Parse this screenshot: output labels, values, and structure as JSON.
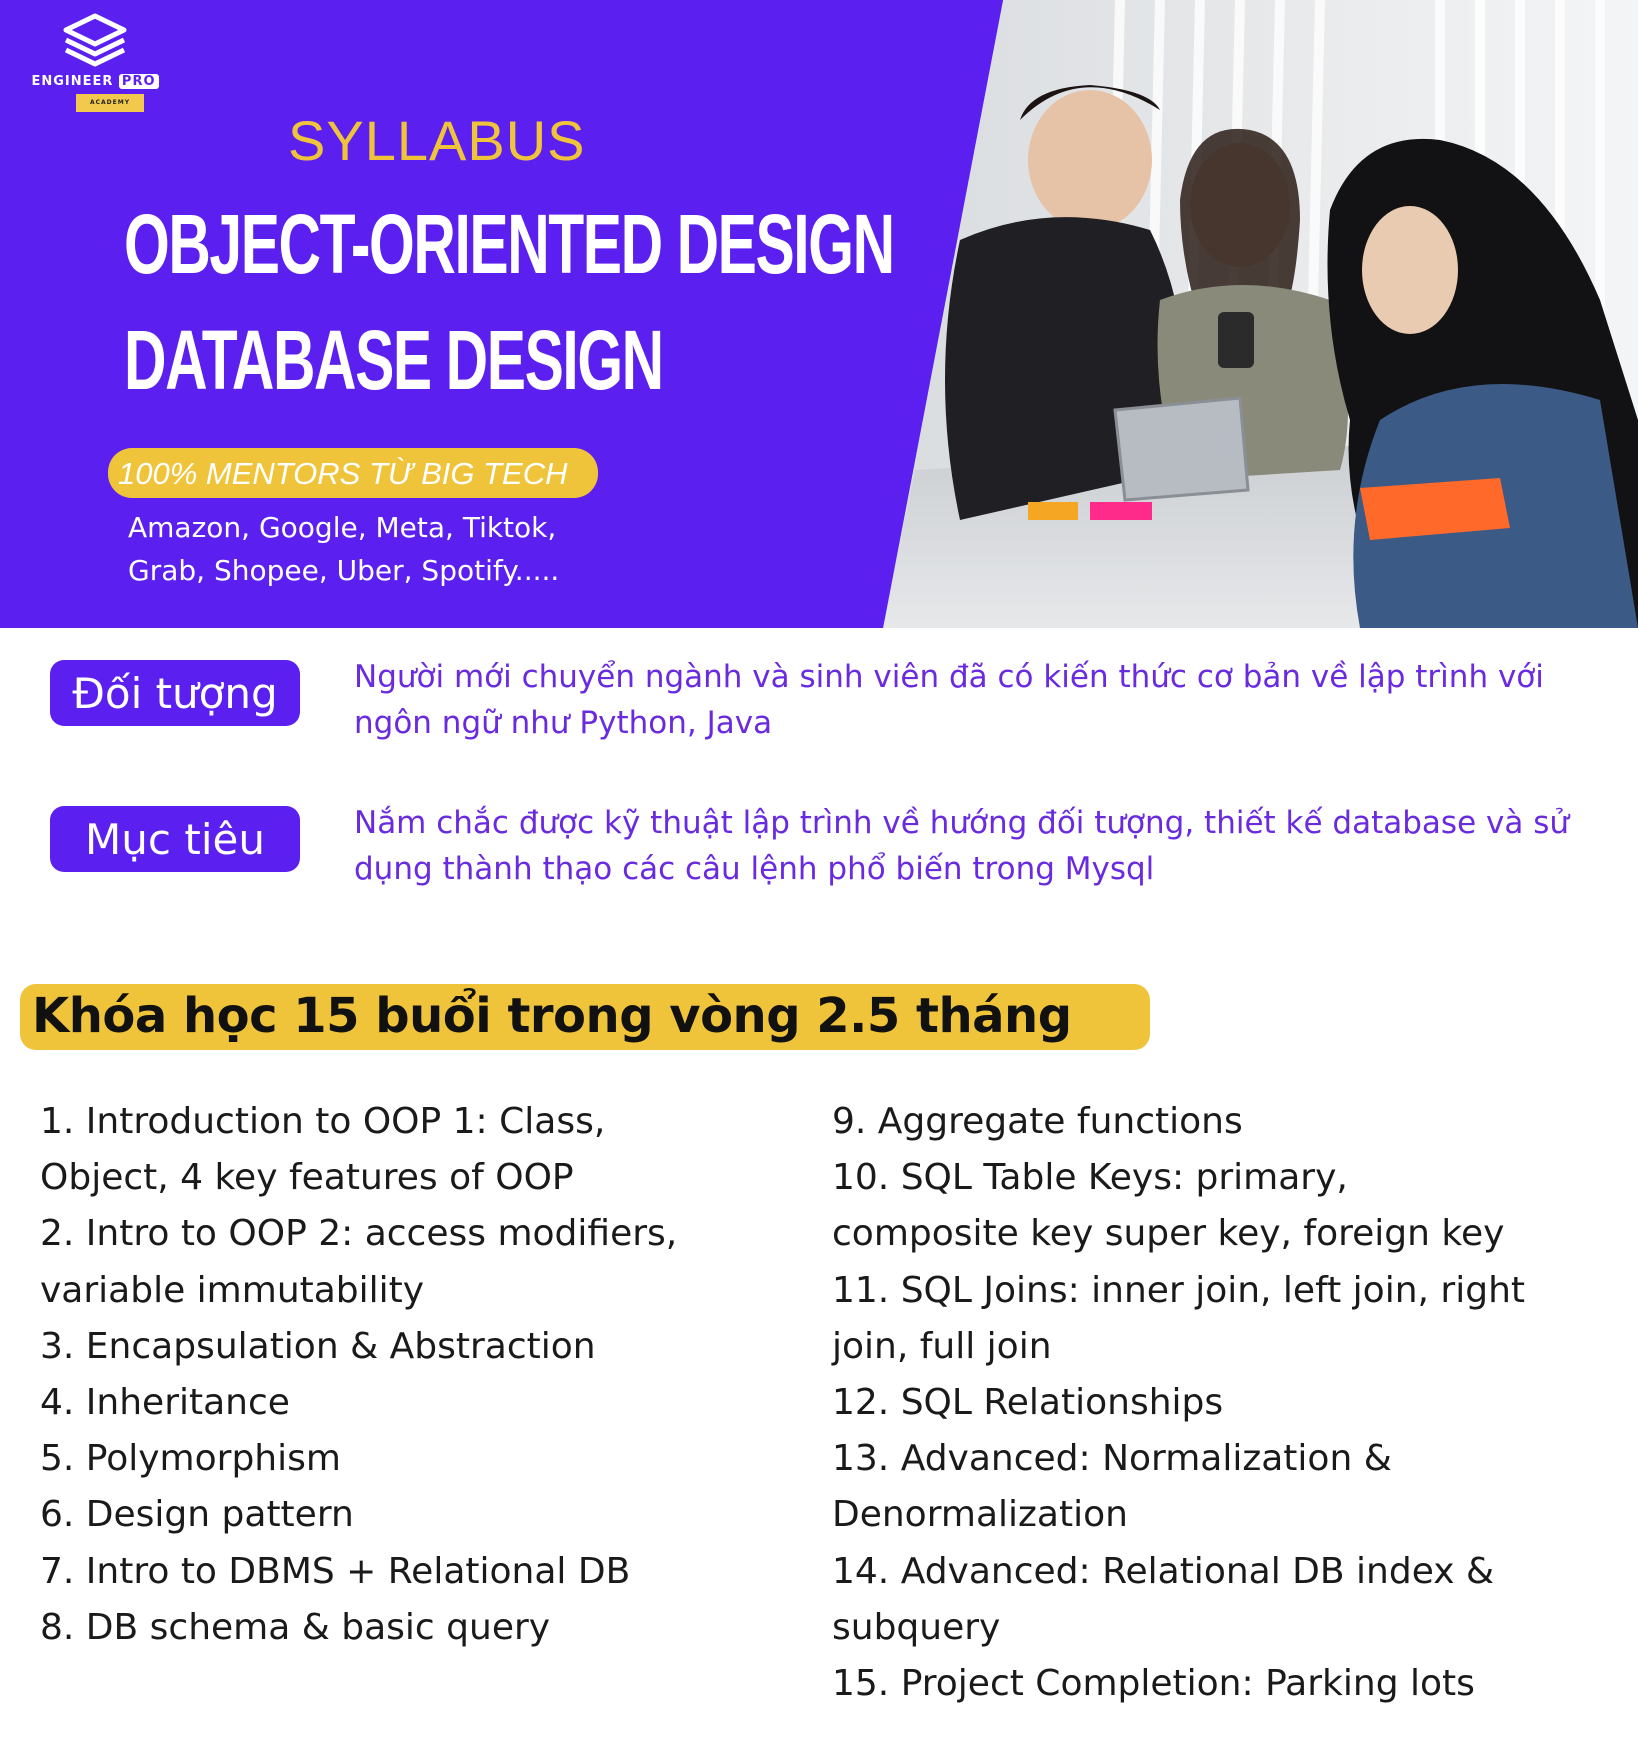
{
  "logo": {
    "name": "ENGINEER",
    "name_suffix": "PRO",
    "tagline": "ACADEMY"
  },
  "hero": {
    "label": "SYLLABUS",
    "title_line1": "OBJECT-ORIENTED DESIGN",
    "title_line2": "DATABASE DESIGN",
    "mentor_pill": "100% MENTORS TỪ BIG TECH",
    "companies_line1": "Amazon, Google, Meta, Tiktok,",
    "companies_line2": "Grab, Shopee, Uber, Spotify.....",
    "colors": {
      "background": "#5b1ff0",
      "accent": "#f0c43a",
      "text": "#ffffff"
    }
  },
  "info": [
    {
      "badge": "Đối tượng",
      "text": "Người mới chuyển ngành và sinh viên đã có kiến thức cơ bản về lập trình với ngôn ngữ như Python, Java"
    },
    {
      "badge": "Mục tiêu",
      "text": "Nắm chắc được kỹ thuật lập trình về hướng đối tượng, thiết kế database và sử dụng thành thạo các câu lệnh phổ biến trong Mysql"
    }
  ],
  "course": {
    "banner": "Khóa học 15 buổi trong vòng 2.5 tháng",
    "lessons_left": [
      "1. Introduction to OOP 1: Class,",
      "Object, 4 key features of OOP",
      "2. Intro to OOP 2: access modifiers,",
      "variable immutability",
      "3. Encapsulation & Abstraction",
      "4. Inheritance",
      "5. Polymorphism",
      "6. Design pattern",
      "7. Intro to DBMS + Relational DB",
      "8. DB schema & basic query"
    ],
    "lessons_right": [
      "9. Aggregate functions",
      "10. SQL Table Keys: primary,",
      "composite key super key, foreign key",
      "11. SQL Joins: inner join, left join, right",
      "join, full join",
      "12. SQL Relationships",
      "13. Advanced: Normalization &",
      "Denormalization",
      "14. Advanced: Relational DB index &",
      "subquery",
      "15. Project Completion: Parking lots"
    ]
  }
}
